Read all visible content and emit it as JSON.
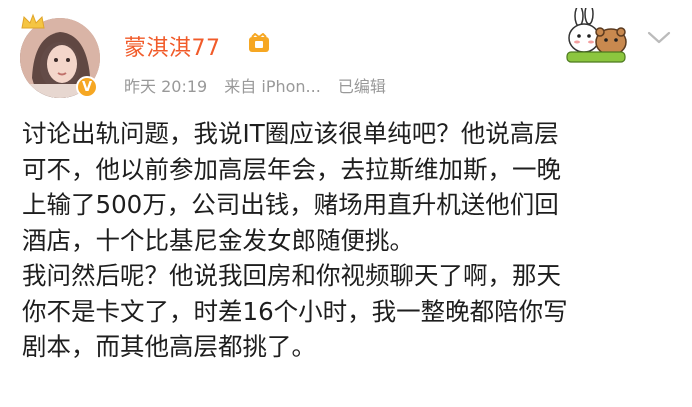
{
  "post": {
    "user": {
      "name": "蒙淇淇77",
      "avatar": "avatar",
      "verified_badge": "V"
    },
    "meta": {
      "time": "昨天 20:19",
      "source": "来自 iPhon...",
      "edited": "已编辑"
    },
    "content_lines": [
      "讨论出轨问题，我说IT圈应该很单纯吧？他说高层",
      "可不，他以前参加高层年会，去拉斯维加斯，一晚",
      "上输了500万，公司出钱，赌场用直升机送他们回",
      "酒店，十个比基尼金发女郎随便挑。",
      "我问然后呢？他说我回房和你视频聊天了啊，那天",
      "你不是卡文了，时差16个小时，我一整晚都陪你写",
      "剧本，而其他高层都挑了。"
    ],
    "icons": {
      "crown": "crown-icon",
      "member": "member-badge-icon",
      "sticker": "sticker-icon",
      "menu": "chevron-down-icon"
    },
    "colors": {
      "username": "#f15b2a",
      "meta": "#999999",
      "badge": "#f6a723"
    }
  }
}
